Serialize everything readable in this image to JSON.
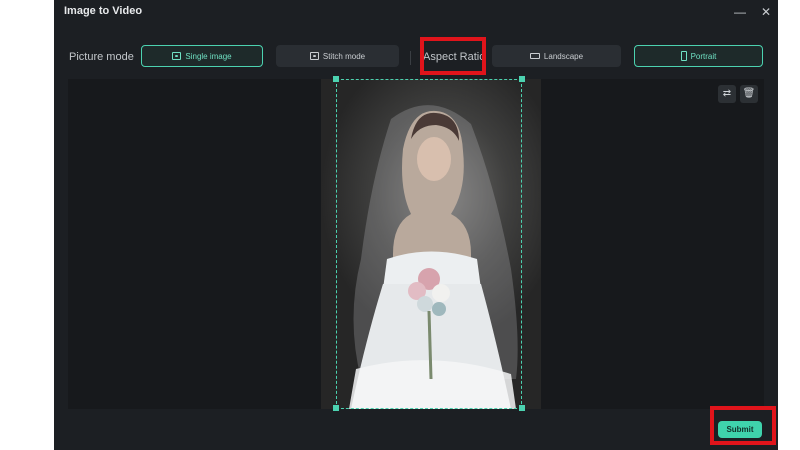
{
  "window": {
    "title": "Image to Video",
    "minimize_icon": "minimize-icon",
    "close_icon": "close-icon"
  },
  "toolbar": {
    "picture_mode_label": "Picture mode",
    "single_image_label": "Single image",
    "stitch_mode_label": "Stitch mode",
    "aspect_ratio_label": "Aspect Ratio",
    "landscape_label": "Landscape",
    "portrait_label": "Portrait",
    "selected_picture_mode": "Single image",
    "selected_aspect_ratio": "Portrait"
  },
  "canvas": {
    "replace_icon": "replace-image-icon",
    "delete_icon": "trash-icon"
  },
  "footer": {
    "submit_label": "Submit"
  },
  "colors": {
    "accent": "#4cd2b0",
    "annotation": "#e0141b",
    "background": "#1c1f23"
  }
}
